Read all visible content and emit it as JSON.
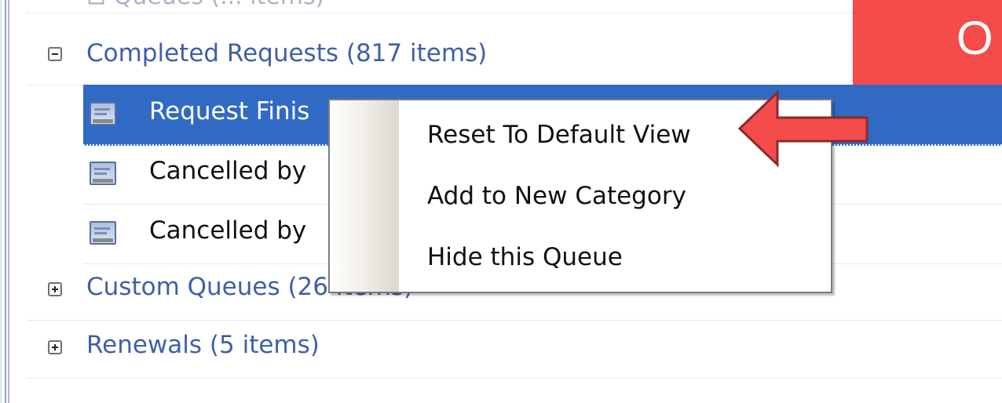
{
  "tree": {
    "cut_off_row_text": "⊟ Queues (... items)",
    "groups": [
      {
        "label": "Completed Requests  (817 items)",
        "expanded": true
      },
      {
        "label": "Custom Queues  (26 items)",
        "expanded": false
      },
      {
        "label": "Renewals  (5 items)",
        "expanded": false
      }
    ],
    "completed_children": [
      {
        "label": "Request Finis",
        "selected": true
      },
      {
        "label": "Cancelled by",
        "selected": false
      },
      {
        "label": "Cancelled by",
        "selected": false
      }
    ]
  },
  "context_menu": {
    "items": [
      {
        "label": "Reset To Default View"
      },
      {
        "label": "Add to New Category"
      },
      {
        "label": "Hide this Queue"
      }
    ]
  },
  "banner": {
    "text": "O",
    "color": "#f44c4b"
  },
  "colors": {
    "selection": "#316ac5",
    "group_text": "#3f5fa9",
    "arrow": "#f44c4b"
  },
  "icons": {
    "expanded": "minus-box-icon",
    "collapsed": "plus-box-icon",
    "queue": "queue-list-icon",
    "pointer": "left-arrow-icon"
  }
}
